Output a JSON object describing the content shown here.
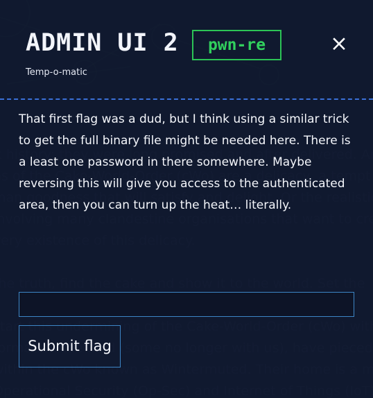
{
  "modal": {
    "title": "ADMIN UI 2",
    "subtitle": "Temp-o-matic",
    "tag": "pwn-re",
    "close_icon": "close-icon",
    "description": "That first flag was a dud, but I think using a similar trick to get the full binary file might be needed here. There is a least one password in there somewhere. Maybe reversing this will give you access to the authenticated area, then you can turn up the heat… literally.",
    "input": {
      "placeholder": "",
      "value": ""
    },
    "submit_label": "Submit flag"
  },
  "background": {
    "lines": [
      "it history: they were long promised and after delivered. Are th",
      "ns of the Cake-World-Order (cWo) are a delicacy, a tempt",
      "man goodness that will satisfy and delight. Or the realistic",
      "involving many clandestine organisations that want to crea",
      "very existence of this delicacy.",
      "",
      "the truth, find the cake and show it to the world. Set the",
      "",
      "start this undermining of the Cake-World-Order (cWo) with",
      "formation the field (some no longer with us), have pieced",
      "within the cWo known as Wintermuted. Their home is a m",
      "Operational Security (Op-Sec) and Internet of Things (IoT) d"
    ]
  },
  "colors": {
    "background": "#131c35",
    "accent": "#3a70d8",
    "tag": "#31d05d",
    "text": "#f4f6fb"
  }
}
